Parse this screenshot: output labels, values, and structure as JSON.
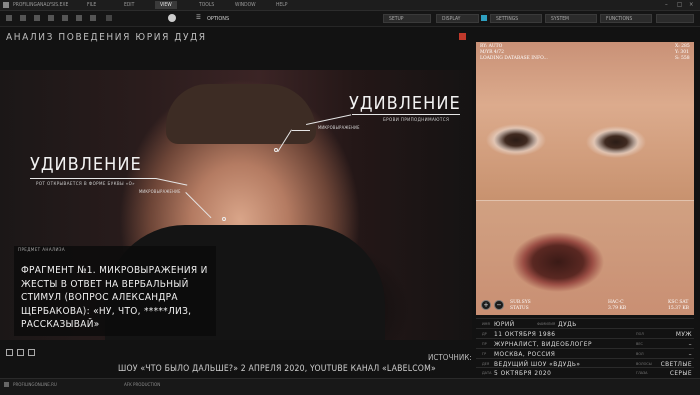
{
  "menu": {
    "app_file": "PROFILINGANALYSIS.EXE",
    "items": [
      "FILE",
      "EDIT",
      "VIEW",
      "TOOLS",
      "WINDOW",
      "HELP"
    ],
    "active": "VIEW"
  },
  "toolbar": {
    "options_label": "OPTIONS",
    "buttons": [
      "SETUP",
      "DISPLAY",
      "SETTINGS",
      "SYSTEM",
      "FUNCTIONS"
    ]
  },
  "title": "АНАЛИЗ ПОВЕДЕНИЯ ЮРИЯ ДУДЯ",
  "annotations": {
    "left_emotion": "УДИВЛЕНИЕ",
    "left_desc": "РОТ ОТКРЫВАЕТСЯ В ФОРМЕ БУКВЫ «О»",
    "left_micro": "МИКРОВЫРАЖЕНИЕ",
    "right_emotion": "УДИВЛЕНИЕ",
    "right_desc": "БРОВИ ПРИПОДНИМАЮТСЯ",
    "right_micro": "МИКРОВЫРАЖЕНИЕ"
  },
  "subject": {
    "tag": "ПРЕДМЕТ АНАЛИЗА",
    "text": "ФРАГМЕНТ №1. МИКРОВЫРАЖЕНИЯ И ЖЕСТЫ В ОТВЕТ НА ВЕРБАЛЬНЫЙ СТИМУЛ (ВОПРОС АЛЕКСАНДРА ЩЕРБАКОВА): «НУ, ЧТО, *****ЛИЗ, РАССКАЗЫВАЙ»"
  },
  "source": {
    "label": "ИСТОЧНИК:",
    "text": "ШОУ «ЧТО БЫЛО ДАЛЬШЕ?» 2 АПРЕЛЯ 2020, YOUTUBE КАНАЛ «LABELCOM»"
  },
  "status": {
    "left": "PROFILINGONLINE.RU",
    "mid": "AFK PRODUCTION"
  },
  "right_panel": {
    "overlay_tl": [
      "RY: AUTO",
      "M/YR 4/72",
      "LOADING DATABASE INFO..."
    ],
    "overlay_tr": [
      "X: 285",
      "Y: 301",
      "S: 558"
    ],
    "bottom_left": [
      "SUB.SYS",
      "STATUS"
    ],
    "bottom_mid": [
      "HAC-C",
      "3.79 KB"
    ],
    "bottom_right": [
      "KSC SAT",
      "15.37 KB"
    ]
  },
  "info": {
    "rows": [
      {
        "k": "ИМЯ",
        "v": "ЮРИЙ",
        "k2": "ФАМИЛИЯ",
        "v2": "ДУДЬ",
        "v2_left": true
      },
      {
        "k": "ДР",
        "v": "11 ОКТЯБРЯ 1986",
        "k2": "ПОЛ",
        "v2": "МУЖ"
      },
      {
        "k": "ПР",
        "v": "ЖУРНАЛИСТ, ВИДЕОБЛОГЕР",
        "k2": "ВЕС",
        "v2": "–"
      },
      {
        "k": "ГР",
        "v": "МОСКВА, РОССИЯ",
        "k2": "ВОЛ",
        "v2": "–"
      },
      {
        "k": "ДЕЯ",
        "v": "ВЕДУЩИЙ ШОУ «ВДУДЬ»",
        "k2": "ВОЛОСЫ",
        "v2": "СВЕТЛЫЕ"
      },
      {
        "k": "ДАТА",
        "v": "5 ОКТЯБРЯ 2020",
        "k2": "ГЛАЗА",
        "v2": "СЕРЫЕ"
      }
    ]
  },
  "colors": {
    "accent_red": "#c0392b",
    "panel_bg": "#121212"
  }
}
